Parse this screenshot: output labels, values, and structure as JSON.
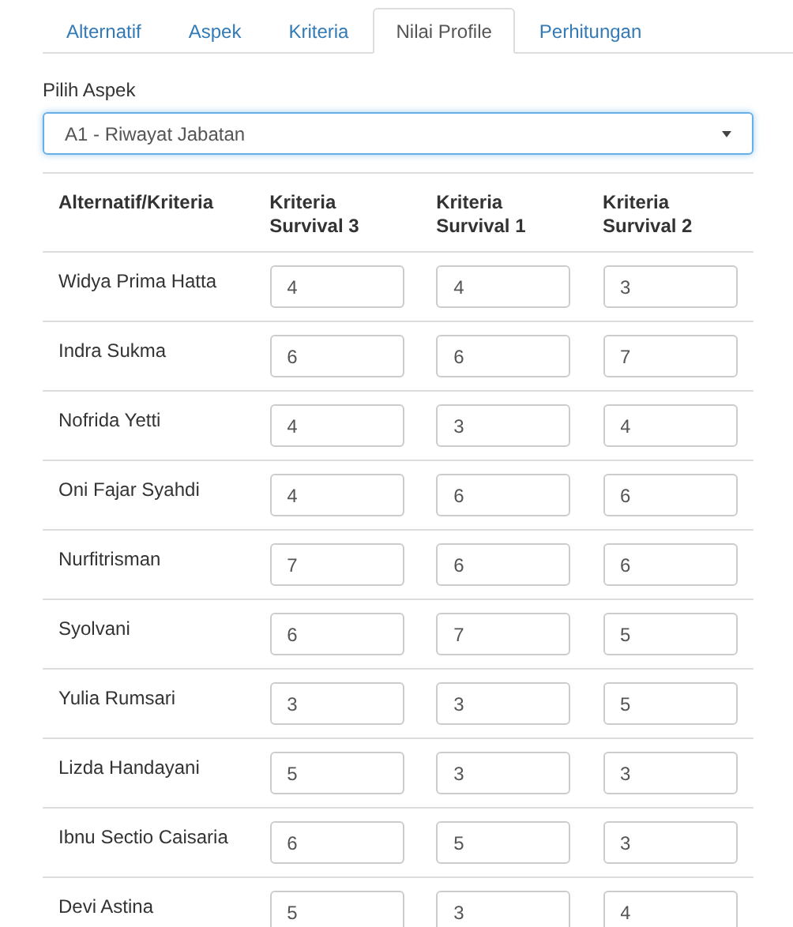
{
  "tabs": [
    {
      "label": "Alternatif",
      "selected": false
    },
    {
      "label": "Aspek",
      "selected": false
    },
    {
      "label": "Kriteria",
      "selected": false
    },
    {
      "label": "Nilai Profile",
      "selected": true
    },
    {
      "label": "Perhitungan",
      "selected": false
    }
  ],
  "aspect_select": {
    "label": "Pilih Aspek",
    "value": "A1 - Riwayat Jabatan"
  },
  "table": {
    "columns": [
      "Alternatif/Kriteria",
      "Kriteria Survival 3",
      "Kriteria Survival 1",
      "Kriteria Survival 2"
    ],
    "rows": [
      {
        "name": "Widya Prima Hatta",
        "values": [
          "4",
          "4",
          "3"
        ]
      },
      {
        "name": "Indra Sukma",
        "values": [
          "6",
          "6",
          "7"
        ]
      },
      {
        "name": "Nofrida Yetti",
        "values": [
          "4",
          "3",
          "4"
        ]
      },
      {
        "name": "Oni Fajar Syahdi",
        "values": [
          "4",
          "6",
          "6"
        ]
      },
      {
        "name": "Nurfitrisman",
        "values": [
          "7",
          "6",
          "6"
        ]
      },
      {
        "name": "Syolvani",
        "values": [
          "6",
          "7",
          "5"
        ]
      },
      {
        "name": "Yulia Rumsari",
        "values": [
          "3",
          "3",
          "5"
        ]
      },
      {
        "name": "Lizda Handayani",
        "values": [
          "5",
          "3",
          "3"
        ]
      },
      {
        "name": "Ibnu Sectio Caisaria",
        "values": [
          "6",
          "5",
          "3"
        ]
      },
      {
        "name": "Devi Astina",
        "values": [
          "5",
          "3",
          "4"
        ]
      }
    ]
  }
}
